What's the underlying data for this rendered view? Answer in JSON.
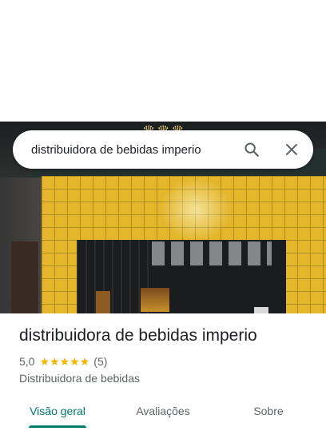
{
  "search": {
    "query": "distribuidora de bebidas imperio"
  },
  "place": {
    "title": "distribuidora de bebidas imperio",
    "rating": "5,0",
    "stars": 5,
    "review_count": "(5)",
    "category": "Distribuidora de bebidas"
  },
  "tabs": [
    {
      "label": "Visão geral",
      "selected": true
    },
    {
      "label": "Avaliações",
      "selected": false
    },
    {
      "label": "Sobre",
      "selected": false
    }
  ],
  "icons": {
    "search": "search-icon",
    "close": "close-icon",
    "star": "star-icon"
  },
  "colors": {
    "accent": "#00796b",
    "star": "#f4b400"
  }
}
